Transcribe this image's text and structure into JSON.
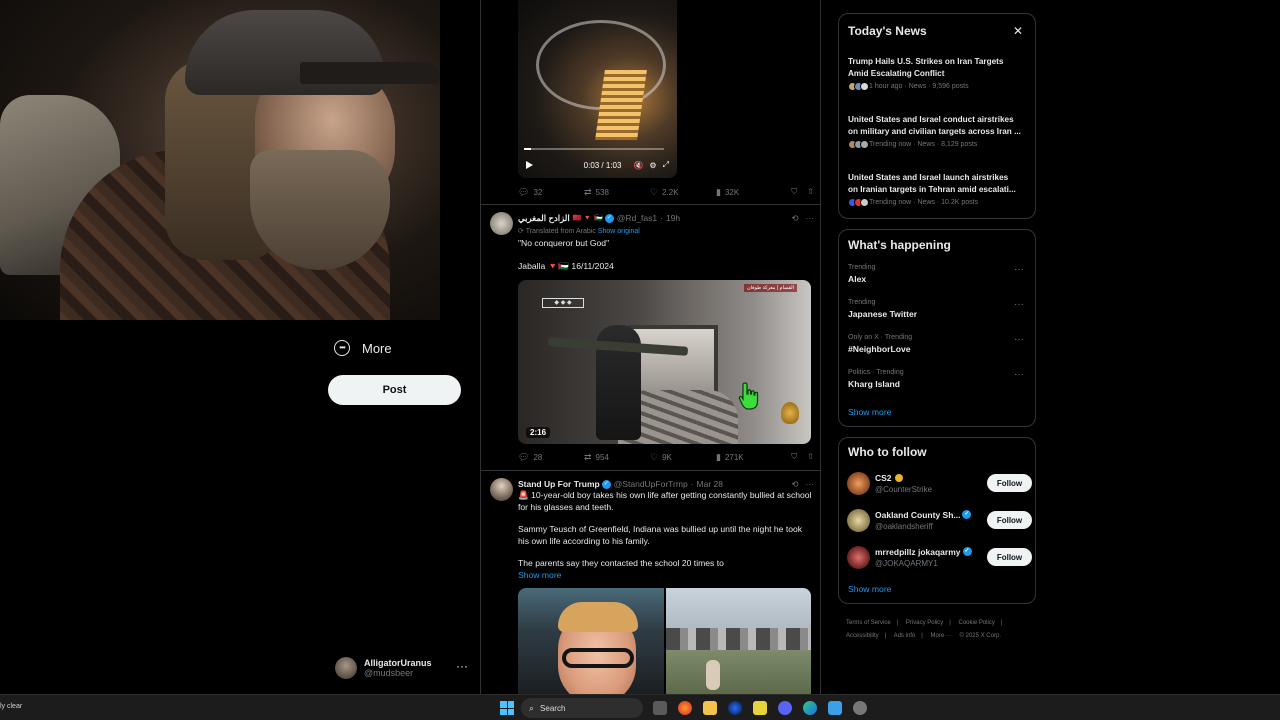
{
  "left_nav": {
    "more_label": "More",
    "post_label": "Post",
    "account": {
      "name": "AlligatorUranus",
      "handle": "@mudsbeer",
      "menu_glyph": "···"
    }
  },
  "tweet1": {
    "video": {
      "time": "0:03 / 1:03",
      "progress": 0.05
    },
    "actions": {
      "replies": "32",
      "reposts": "538",
      "likes": "2.2K",
      "views": "32K"
    }
  },
  "tweet2": {
    "name": "الزادح المغربي",
    "flags": "🇲🇦 🔻 🇵🇸",
    "handle": "@Rd_fas1",
    "time": "19h",
    "translated_label": "Translated from Arabic",
    "show_original": "Show original",
    "text_line1": "\"No conqueror but God\"",
    "text_line2": "Jaballa 🔻🇵🇸 16/11/2024",
    "video_duration": "2:16",
    "video_logo_tr": "القسام | معركة طوفان",
    "actions": {
      "replies": "28",
      "reposts": "954",
      "likes": "9K",
      "views": "271K"
    }
  },
  "tweet3": {
    "name": "Stand Up For Trump",
    "handle": "@StandUpForTrmp",
    "time": "Mar 28",
    "para1": "🚨 10-year-old boy takes his own life after getting constantly bullied at school for his glasses and teeth.",
    "para2": "Sammy Teusch of Greenfield, Indiana was bullied up until the night he took his own life according to his family.",
    "para3": "The parents say they contacted the school 20 times to",
    "show_more": "Show more"
  },
  "todays_news": {
    "title": "Today's News",
    "items": [
      {
        "title_l1": "Trump Hails U.S. Strikes on Iran Targets",
        "title_l2": "Amid Escalating Conflict",
        "meta": "1 hour ago · News · 9,596 posts"
      },
      {
        "title_l1": "United States and Israel conduct airstrikes",
        "title_l2": "on military and civilian targets across Iran ...",
        "meta": "Trending now · News · 8,129 posts"
      },
      {
        "title_l1": "United States and Israel launch airstrikes",
        "title_l2": "on Iranian targets in Tehran amid escalati...",
        "meta": "Trending now · News · 10.2K posts"
      }
    ]
  },
  "whats_happening": {
    "title": "What's happening",
    "trends": [
      {
        "category": "Trending",
        "name": "Alex"
      },
      {
        "category": "Trending",
        "name": "Japanese Twitter"
      },
      {
        "category": "Only on X · Trending",
        "name": "#NeighborLove"
      },
      {
        "category": "Politics · Trending",
        "name": "Kharg Island"
      }
    ],
    "show_more": "Show more"
  },
  "who_to_follow": {
    "title": "Who to follow",
    "accounts": [
      {
        "name": "CS2",
        "handle": "@CounterStrike",
        "follow": "Follow"
      },
      {
        "name": "Oakland County Sh...",
        "handle": "@oaklandsheriff",
        "follow": "Follow"
      },
      {
        "name": "mrredpillz jokaqarmy",
        "handle": "@JOKAQARMY1",
        "follow": "Follow"
      }
    ],
    "show_more": "Show more"
  },
  "footer": {
    "links": [
      "Terms of Service",
      "|",
      "Privacy Policy",
      "|",
      "Cookie Policy",
      "|",
      "Accessibility",
      "|",
      "Ads info",
      "|",
      "More ···",
      "© 2025 X Corp."
    ]
  },
  "taskbar": {
    "weather": "ly clear",
    "search_placeholder": "Search"
  },
  "colors": {
    "accent": "#1d9bf0",
    "background": "#000000",
    "text": "#e7e9ea",
    "muted": "#71767b"
  }
}
